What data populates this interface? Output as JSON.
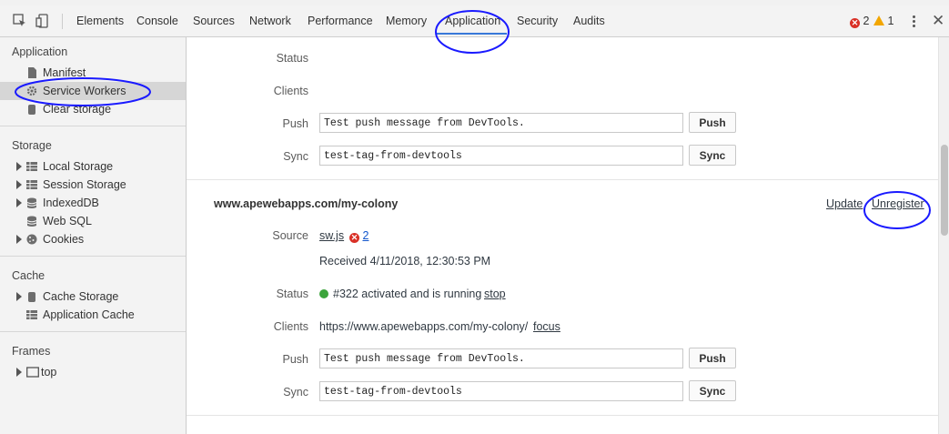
{
  "tabs": [
    "Elements",
    "Console",
    "Sources",
    "Network",
    "Performance",
    "Memory",
    "Application",
    "Security",
    "Audits"
  ],
  "active_tab": "Application",
  "errors_count": "2",
  "warnings_count": "1",
  "sidebar": {
    "application": {
      "title": "Application",
      "items": [
        "Manifest",
        "Service Workers",
        "Clear storage"
      ]
    },
    "storage": {
      "title": "Storage",
      "items": [
        "Local Storage",
        "Session Storage",
        "IndexedDB",
        "Web SQL",
        "Cookies"
      ]
    },
    "cache": {
      "title": "Cache",
      "items": [
        "Cache Storage",
        "Application Cache"
      ]
    },
    "frames": {
      "title": "Frames",
      "items": [
        "top"
      ]
    }
  },
  "worker1": {
    "status_label": "Status",
    "clients_label": "Clients",
    "push_label": "Push",
    "push_value": "Test push message from DevTools.",
    "push_button": "Push",
    "sync_label": "Sync",
    "sync_value": "test-tag-from-devtools",
    "sync_button": "Sync"
  },
  "worker2": {
    "scope": "www.apewebapps.com/my-colony",
    "update_link": "Update",
    "unregister_link": "Unregister",
    "source_label": "Source",
    "source_file": "sw.js",
    "source_errors": "2",
    "received": "Received 4/11/2018, 12:30:53 PM",
    "status_label": "Status",
    "status_text": "#322 activated and is running",
    "stop_link": "stop",
    "clients_label": "Clients",
    "client_url": "https://www.apewebapps.com/my-colony/",
    "focus_link": "focus",
    "push_label": "Push",
    "push_value": "Test push message from DevTools.",
    "push_button": "Push",
    "sync_label": "Sync",
    "sync_value": "test-tag-from-devtools",
    "sync_button": "Sync"
  },
  "colors": {
    "accent": "#3879d9",
    "link": "#1155cc",
    "status_running": "#3ba43b",
    "annotation": "#1a1aff"
  }
}
